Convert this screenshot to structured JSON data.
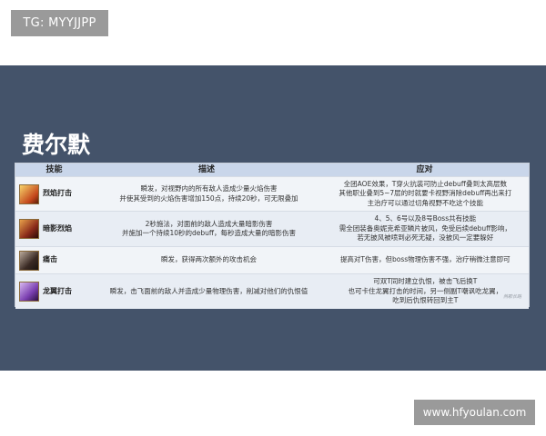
{
  "tag": "TG: MYYJJPP",
  "title": "费尔默",
  "table": {
    "headers": [
      "技能",
      "描述",
      "应对"
    ],
    "rows": [
      {
        "skill": "烈焰打击",
        "icon": "fire-skill-icon",
        "desc": [
          "瞬发，对视野内的所有敌人造成少量火焰伤害",
          "并使其受到的火焰伤害增加150点，持续20秒，可无限叠加"
        ],
        "resp": [
          "全团AOE效果，T穿火抗装可防止debuff叠到太高层数",
          "其他职业叠到5~7层的时就要卡视野消除debuff再出来打",
          "主治疗可以通过切角视野不吃这个技能"
        ]
      },
      {
        "skill": "暗影烈焰",
        "icon": "shadowflame-skill-icon",
        "desc": [
          "2秒施法，对面前的敌人造成大量暗影伤害",
          "并施加一个持续10秒的debuff，每秒造成大量的暗影伤害"
        ],
        "resp": [
          "4、5、6号以及8号Boss共有技能",
          "需全团装备奥妮克希亚鳞片披风，免受后续debuff影响，",
          "若无披风被喷到必死无疑，没披风一定要躲好"
        ]
      },
      {
        "skill": "痛击",
        "icon": "rend-skill-icon",
        "desc": [
          "瞬发，获得两次额外的攻击机会"
        ],
        "resp": [
          "提高对T伤害，但boss物理伤害不强，治疗稍微注意即可"
        ]
      },
      {
        "skill": "龙翼打击",
        "icon": "wing-buffet-skill-icon",
        "desc": [
          "瞬发，击飞面前的敌人并造成少量物理伤害，削减对他们的仇恨值"
        ],
        "resp": [
          "可双T同时建立仇恨，被击飞后换T",
          "也可卡住龙翼打击的时间，另一侧副T嘲讽吃龙翼，",
          "吃到后仇恨转回到主T"
        ]
      }
    ]
  },
  "watermark": "燕歌长路",
  "site": "www.hfyoulan.com"
}
